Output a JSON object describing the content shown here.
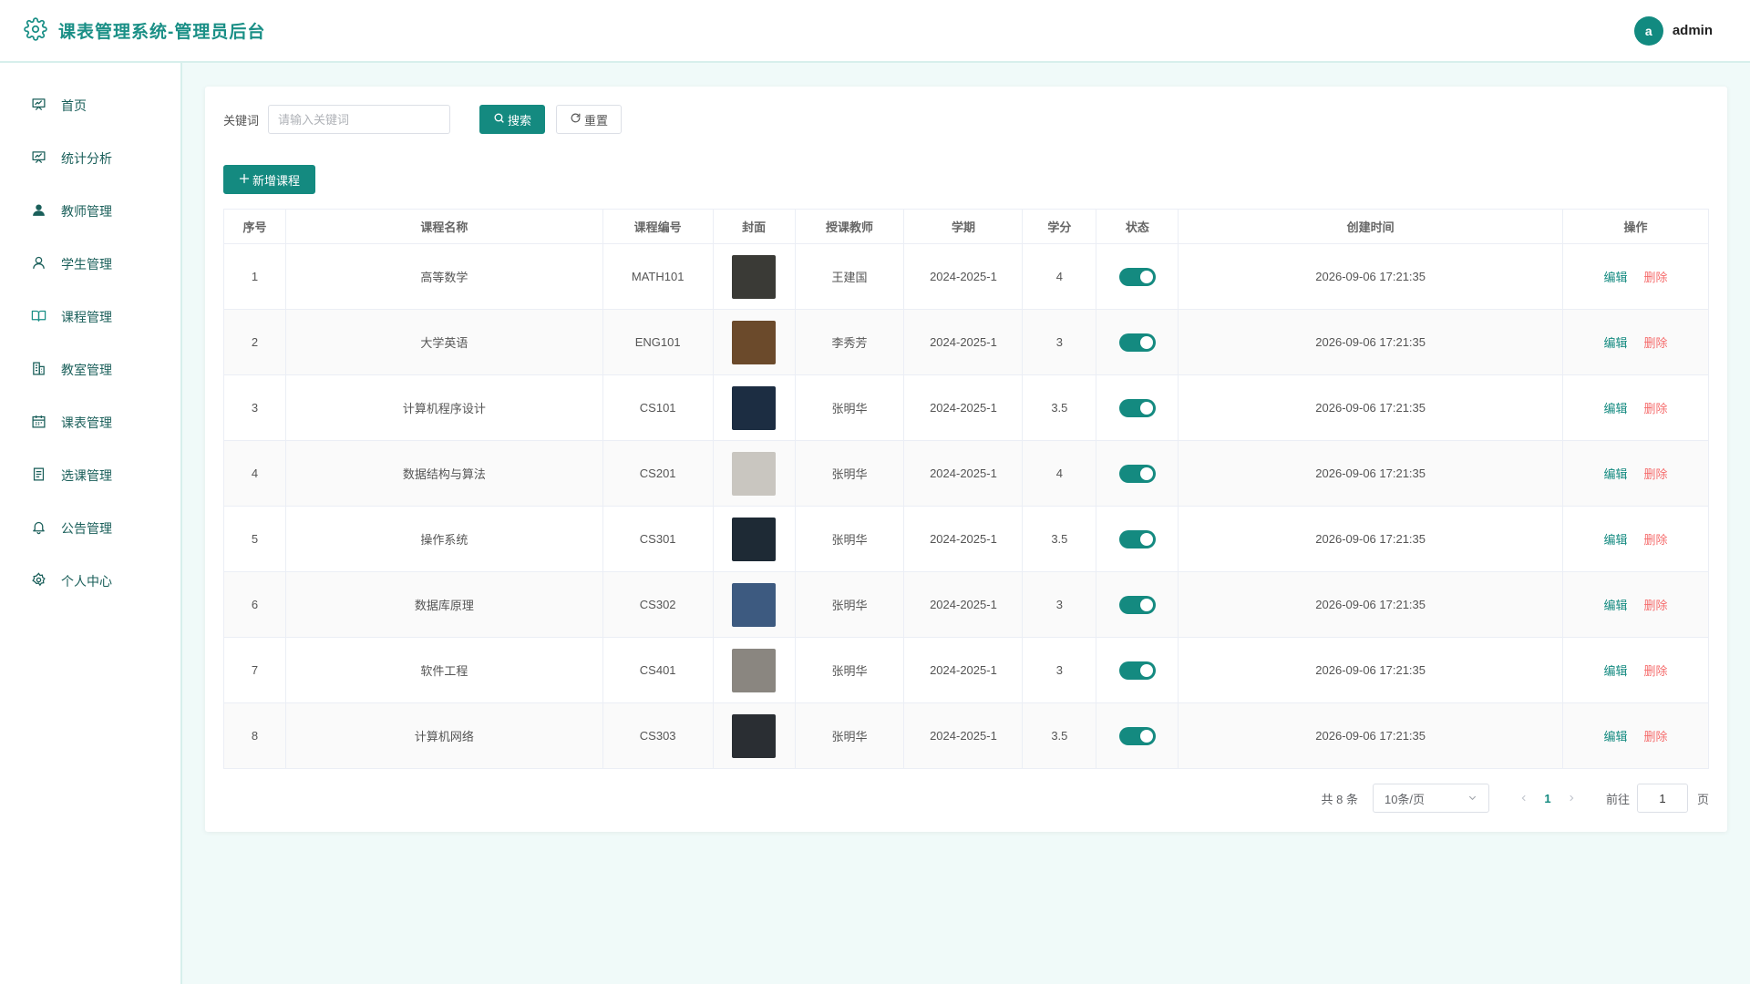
{
  "header": {
    "title": "课表管理系统-管理员后台",
    "user_initial": "a",
    "username": "admin"
  },
  "sidebar": {
    "items": [
      {
        "label": "首页",
        "icon": "presentation-icon"
      },
      {
        "label": "统计分析",
        "icon": "presentation-icon"
      },
      {
        "label": "教师管理",
        "icon": "user-filled-icon"
      },
      {
        "label": "学生管理",
        "icon": "user-icon"
      },
      {
        "label": "课程管理",
        "icon": "book-icon"
      },
      {
        "label": "教室管理",
        "icon": "building-icon"
      },
      {
        "label": "课表管理",
        "icon": "calendar-icon"
      },
      {
        "label": "选课管理",
        "icon": "document-icon"
      },
      {
        "label": "公告管理",
        "icon": "bell-icon"
      },
      {
        "label": "个人中心",
        "icon": "gear-icon"
      }
    ]
  },
  "search": {
    "label": "关键词",
    "placeholder": "请输入关键词",
    "value": "",
    "search_button": "搜索",
    "reset_button": "重置"
  },
  "toolbar": {
    "add_button": "新增课程"
  },
  "table": {
    "columns": [
      "序号",
      "课程名称",
      "课程编号",
      "封面",
      "授课教师",
      "学期",
      "学分",
      "状态",
      "创建时间",
      "操作"
    ],
    "edit_label": "编辑",
    "delete_label": "删除",
    "rows": [
      {
        "no": "1",
        "name": "高等数学",
        "code": "MATH101",
        "teacher": "王建国",
        "term": "2024-2025-1",
        "credit": "4",
        "enabled": true,
        "created": "2026-09-06 17:21:35",
        "cover_color": "#3a3a36"
      },
      {
        "no": "2",
        "name": "大学英语",
        "code": "ENG101",
        "teacher": "李秀芳",
        "term": "2024-2025-1",
        "credit": "3",
        "enabled": true,
        "created": "2026-09-06 17:21:35",
        "cover_color": "#6b4a2b"
      },
      {
        "no": "3",
        "name": "计算机程序设计",
        "code": "CS101",
        "teacher": "张明华",
        "term": "2024-2025-1",
        "credit": "3.5",
        "enabled": true,
        "created": "2026-09-06 17:21:35",
        "cover_color": "#1c2d42"
      },
      {
        "no": "4",
        "name": "数据结构与算法",
        "code": "CS201",
        "teacher": "张明华",
        "term": "2024-2025-1",
        "credit": "4",
        "enabled": true,
        "created": "2026-09-06 17:21:35",
        "cover_color": "#c9c6c0"
      },
      {
        "no": "5",
        "name": "操作系统",
        "code": "CS301",
        "teacher": "张明华",
        "term": "2024-2025-1",
        "credit": "3.5",
        "enabled": true,
        "created": "2026-09-06 17:21:35",
        "cover_color": "#1e2a35"
      },
      {
        "no": "6",
        "name": "数据库原理",
        "code": "CS302",
        "teacher": "张明华",
        "term": "2024-2025-1",
        "credit": "3",
        "enabled": true,
        "created": "2026-09-06 17:21:35",
        "cover_color": "#3d5a80"
      },
      {
        "no": "7",
        "name": "软件工程",
        "code": "CS401",
        "teacher": "张明华",
        "term": "2024-2025-1",
        "credit": "3",
        "enabled": true,
        "created": "2026-09-06 17:21:35",
        "cover_color": "#8a8680"
      },
      {
        "no": "8",
        "name": "计算机网络",
        "code": "CS303",
        "teacher": "张明华",
        "term": "2024-2025-1",
        "credit": "3.5",
        "enabled": true,
        "created": "2026-09-06 17:21:35",
        "cover_color": "#2a2e33"
      }
    ]
  },
  "pagination": {
    "total_text": "共 8 条",
    "page_size": "10条/页",
    "current_page": "1",
    "goto_label": "前往",
    "goto_value": "1",
    "goto_suffix": "页"
  },
  "colors": {
    "accent": "#148a80",
    "danger": "#f56c6c"
  }
}
